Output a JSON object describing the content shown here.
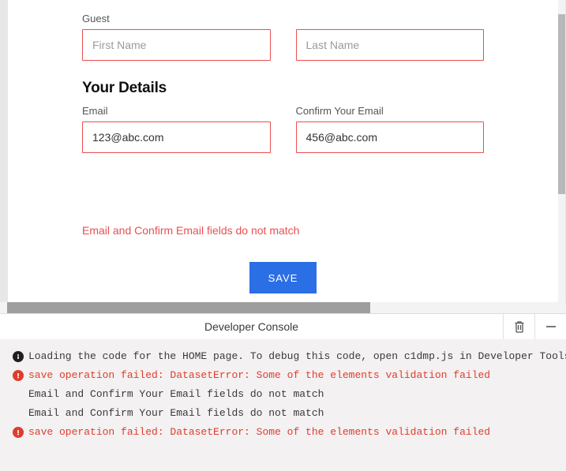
{
  "form": {
    "guest": {
      "label": "Guest",
      "first_placeholder": "First Name",
      "last_placeholder": "Last Name"
    },
    "details": {
      "heading": "Your Details",
      "email_label": "Email",
      "confirm_label": "Confirm Your Email",
      "email_value": "123@abc.com",
      "confirm_value": "456@abc.com"
    },
    "error_text": "Email and Confirm Email fields do not match",
    "save_label": "SAVE"
  },
  "console": {
    "title": "Developer Console",
    "logs": [
      {
        "level": "info",
        "text": "Loading the code for the HOME page. To debug this code, open c1dmp.js in Developer Tools."
      },
      {
        "level": "error",
        "text": "save operation failed: DatasetError: Some of the elements validation failed"
      },
      {
        "level": "log",
        "text": "Email and Confirm Your Email fields do not match"
      },
      {
        "level": "log",
        "text": "Email and Confirm Your Email fields do not match"
      },
      {
        "level": "error",
        "text": "save operation failed: DatasetError: Some of the elements validation failed"
      }
    ]
  },
  "colors": {
    "error": "#e94f4f",
    "primary": "#2b6fe6",
    "console_error": "#e03c2e"
  }
}
